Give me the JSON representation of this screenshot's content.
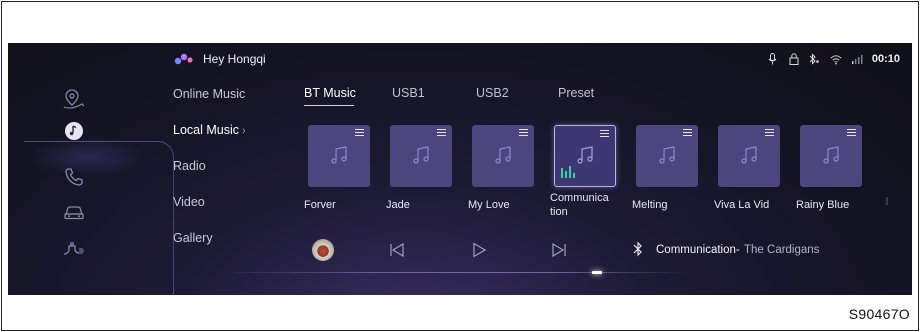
{
  "status_bar": {
    "time": "00:10",
    "icons": [
      "microphone-icon",
      "lock-icon",
      "bluetooth-icon",
      "wifi-icon",
      "signal-icon"
    ]
  },
  "assistant": {
    "name": "Hey Hongqi"
  },
  "rail": {
    "items": [
      "navigation-icon",
      "music-icon",
      "phone-icon",
      "car-icon",
      "charging-icon"
    ],
    "active": "music-icon"
  },
  "categories": [
    {
      "label": "Online Music",
      "active": false
    },
    {
      "label": "Local Music",
      "active": true,
      "chevron": "›"
    },
    {
      "label": "Radio",
      "active": false
    },
    {
      "label": "Video",
      "active": false
    },
    {
      "label": "Gallery",
      "active": false
    }
  ],
  "tabs": [
    {
      "label": "BT Music",
      "active": true
    },
    {
      "label": "USB1",
      "active": false
    },
    {
      "label": "USB2",
      "active": false
    },
    {
      "label": "Preset",
      "active": false
    }
  ],
  "songs": [
    {
      "title": "Forver",
      "active": false
    },
    {
      "title": "Jade",
      "active": false
    },
    {
      "title": "My Love",
      "active": false
    },
    {
      "title": "Communica\ntion",
      "active": true
    },
    {
      "title": "Melting",
      "active": false
    },
    {
      "title": "Viva La Vid",
      "active": false
    },
    {
      "title": "Rainy Blue",
      "active": false
    }
  ],
  "player": {
    "now_playing_title": "Communication-",
    "now_playing_artist": "The Cardigans",
    "controls": [
      "previous-icon",
      "play-icon",
      "next-icon"
    ],
    "progress": 0.8
  },
  "figure_code": "S90467O",
  "colors": {
    "screen_bg": "#141322",
    "tile_bg": "#4d467e",
    "tile_active_border": "#b8b2ee",
    "equalizer": "#3bd29a"
  }
}
